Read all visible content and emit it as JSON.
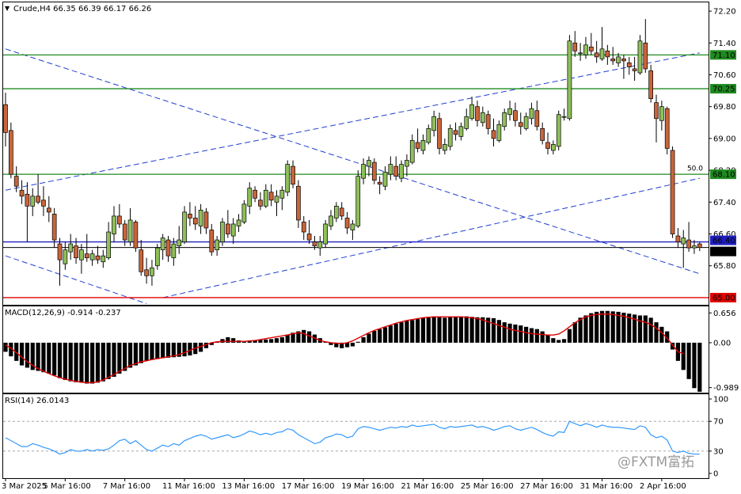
{
  "header": {
    "symbol_caret": "▼",
    "title": "Crude,H4  66.35 66.39 66.17 66.26"
  },
  "watermark": "@FXTM富拓",
  "colors": {
    "bull": "#8fbf5a",
    "bear": "#c8653a",
    "candle_outline": "#000000",
    "level_green": "#1f8a1f",
    "level_red": "#e00000",
    "level_blue": "#1f1fbf",
    "trend_blue": "#1f3fd0",
    "macd_signal": "#e00000",
    "rsi_line": "#3399ff",
    "grid": "#999999"
  },
  "chart_data": [
    {
      "type": "candlestick",
      "name": "main",
      "x_tick_labels": [
        "3 Mar 2025",
        "5 Mar 16:00",
        "7 Mar 16:00",
        "11 Mar 16:00",
        "13 Mar 16:00",
        "17 Mar 16:00",
        "19 Mar 16:00",
        "21 Mar 16:00",
        "25 Mar 16:00",
        "27 Mar 16:00",
        "31 Mar 16:00",
        "2 Apr 16:00"
      ],
      "y_ticks": [
        65.8,
        66.6,
        67.4,
        68.2,
        69.0,
        69.8,
        70.6,
        71.4,
        72.2
      ],
      "ylim": [
        64.82,
        72.42
      ],
      "ohlc": [
        [
          69.85,
          70.15,
          68.8,
          69.15
        ],
        [
          69.2,
          69.4,
          68.0,
          68.1
        ],
        [
          68.05,
          68.3,
          67.65,
          67.8
        ],
        [
          67.7,
          67.95,
          67.35,
          67.55
        ],
        [
          67.6,
          67.9,
          66.4,
          67.3
        ],
        [
          67.3,
          67.75,
          67.05,
          67.55
        ],
        [
          67.55,
          68.1,
          67.35,
          67.4
        ],
        [
          67.45,
          67.8,
          67.05,
          67.3
        ],
        [
          67.25,
          67.55,
          66.9,
          67.15
        ],
        [
          67.1,
          67.25,
          66.25,
          66.45
        ],
        [
          66.35,
          66.5,
          65.3,
          65.95
        ],
        [
          65.85,
          66.4,
          65.7,
          66.2
        ],
        [
          66.15,
          66.6,
          65.95,
          66.35
        ],
        [
          66.3,
          66.5,
          65.85,
          66.0
        ],
        [
          65.95,
          66.35,
          65.6,
          66.2
        ],
        [
          66.1,
          66.6,
          65.9,
          66.0
        ],
        [
          65.95,
          66.2,
          65.8,
          66.1
        ],
        [
          66.05,
          66.3,
          65.85,
          65.95
        ],
        [
          65.9,
          66.2,
          65.75,
          66.05
        ],
        [
          66.0,
          66.9,
          65.95,
          66.65
        ],
        [
          66.6,
          67.3,
          66.4,
          67.05
        ],
        [
          67.05,
          67.35,
          66.75,
          66.85
        ],
        [
          66.85,
          66.95,
          66.3,
          66.45
        ],
        [
          66.4,
          67.25,
          66.3,
          66.95
        ],
        [
          66.9,
          66.95,
          66.15,
          66.25
        ],
        [
          66.2,
          66.45,
          65.55,
          65.65
        ],
        [
          65.7,
          66.0,
          65.35,
          65.55
        ],
        [
          65.55,
          65.95,
          65.3,
          65.75
        ],
        [
          65.8,
          66.35,
          65.7,
          66.25
        ],
        [
          66.2,
          66.6,
          65.95,
          66.5
        ],
        [
          66.45,
          66.55,
          65.9,
          66.05
        ],
        [
          66.0,
          66.5,
          65.8,
          66.35
        ],
        [
          66.3,
          66.8,
          66.1,
          66.45
        ],
        [
          66.4,
          67.3,
          66.35,
          67.15
        ],
        [
          67.1,
          67.4,
          66.8,
          67.0
        ],
        [
          67.0,
          67.3,
          66.7,
          66.85
        ],
        [
          66.8,
          67.35,
          66.6,
          67.2
        ],
        [
          67.15,
          67.25,
          66.6,
          66.75
        ],
        [
          66.7,
          66.85,
          66.05,
          66.15
        ],
        [
          66.2,
          66.55,
          66.05,
          66.45
        ],
        [
          66.4,
          67.0,
          66.3,
          66.9
        ],
        [
          66.85,
          67.2,
          66.5,
          66.6
        ],
        [
          66.55,
          67.0,
          66.35,
          66.85
        ],
        [
          66.8,
          67.1,
          66.65,
          66.95
        ],
        [
          66.9,
          67.45,
          66.85,
          67.35
        ],
        [
          67.3,
          67.9,
          67.1,
          67.75
        ],
        [
          67.7,
          67.8,
          67.4,
          67.5
        ],
        [
          67.45,
          67.65,
          67.2,
          67.3
        ],
        [
          67.3,
          67.85,
          67.25,
          67.7
        ],
        [
          67.65,
          67.85,
          67.3,
          67.45
        ],
        [
          67.4,
          67.7,
          67.05,
          67.55
        ],
        [
          67.5,
          67.8,
          67.2,
          67.7
        ],
        [
          67.65,
          68.45,
          67.55,
          68.35
        ],
        [
          68.3,
          68.45,
          67.75,
          67.85
        ],
        [
          67.8,
          67.95,
          66.75,
          66.95
        ],
        [
          66.9,
          67.05,
          66.45,
          66.65
        ],
        [
          66.6,
          66.95,
          66.35,
          66.45
        ],
        [
          66.4,
          66.55,
          66.2,
          66.3
        ],
        [
          66.25,
          66.55,
          66.05,
          66.4
        ],
        [
          66.35,
          66.95,
          66.25,
          66.85
        ],
        [
          66.8,
          67.2,
          66.7,
          67.05
        ],
        [
          67.0,
          67.4,
          66.9,
          67.3
        ],
        [
          67.25,
          67.4,
          66.95,
          67.05
        ],
        [
          67.0,
          67.15,
          66.6,
          66.75
        ],
        [
          66.7,
          66.95,
          66.45,
          66.85
        ],
        [
          66.8,
          68.2,
          66.75,
          68.05
        ],
        [
          68.0,
          68.5,
          67.85,
          68.35
        ],
        [
          68.3,
          68.55,
          68.05,
          68.45
        ],
        [
          68.4,
          68.5,
          67.85,
          67.95
        ],
        [
          67.9,
          68.05,
          67.6,
          67.85
        ],
        [
          67.8,
          68.3,
          67.7,
          68.15
        ],
        [
          68.1,
          68.55,
          67.95,
          68.35
        ],
        [
          68.3,
          68.55,
          67.95,
          68.05
        ],
        [
          68.0,
          68.45,
          67.9,
          68.35
        ],
        [
          68.3,
          68.6,
          68.05,
          68.45
        ],
        [
          68.4,
          69.1,
          68.35,
          68.95
        ],
        [
          68.9,
          69.25,
          68.65,
          68.75
        ],
        [
          68.7,
          69.1,
          68.6,
          68.95
        ],
        [
          68.9,
          69.35,
          68.85,
          69.25
        ],
        [
          69.2,
          69.7,
          69.05,
          69.55
        ],
        [
          69.5,
          69.65,
          68.6,
          68.75
        ],
        [
          68.7,
          69.0,
          68.6,
          68.85
        ],
        [
          68.8,
          69.35,
          68.7,
          69.25
        ],
        [
          69.2,
          69.4,
          68.95,
          69.1
        ],
        [
          69.05,
          69.4,
          68.95,
          69.3
        ],
        [
          69.25,
          69.75,
          69.2,
          69.55
        ],
        [
          69.5,
          70.05,
          69.45,
          69.85
        ],
        [
          69.8,
          69.95,
          69.3,
          69.45
        ],
        [
          69.4,
          69.8,
          69.3,
          69.65
        ],
        [
          69.6,
          69.7,
          69.1,
          69.25
        ],
        [
          69.2,
          69.5,
          68.8,
          69.0
        ],
        [
          68.95,
          69.45,
          68.9,
          69.35
        ],
        [
          69.3,
          69.75,
          69.2,
          69.65
        ],
        [
          69.6,
          69.95,
          69.45,
          69.75
        ],
        [
          69.7,
          69.9,
          69.3,
          69.45
        ],
        [
          69.4,
          69.65,
          69.1,
          69.3
        ],
        [
          69.25,
          69.65,
          69.2,
          69.55
        ],
        [
          69.5,
          69.9,
          69.35,
          69.75
        ],
        [
          69.7,
          69.95,
          69.2,
          69.3
        ],
        [
          69.25,
          69.4,
          68.85,
          68.95
        ],
        [
          68.9,
          69.15,
          68.6,
          68.75
        ],
        [
          68.7,
          68.95,
          68.6,
          68.85
        ],
        [
          68.8,
          69.7,
          68.7,
          69.6
        ],
        [
          69.55,
          69.75,
          69.45,
          69.55
        ],
        [
          69.5,
          71.6,
          69.45,
          71.45
        ],
        [
          71.4,
          71.7,
          71.05,
          71.2
        ],
        [
          71.15,
          71.4,
          70.95,
          71.15
        ],
        [
          71.1,
          71.55,
          71.0,
          71.35
        ],
        [
          71.3,
          71.65,
          71.1,
          71.2
        ],
        [
          71.15,
          71.45,
          70.9,
          71.05
        ],
        [
          71.0,
          71.8,
          70.95,
          71.25
        ],
        [
          71.2,
          71.35,
          70.85,
          71.05
        ],
        [
          71.0,
          71.3,
          70.85,
          70.95
        ],
        [
          70.9,
          71.15,
          70.8,
          71.05
        ],
        [
          71.0,
          71.1,
          70.5,
          70.95
        ],
        [
          70.9,
          71.05,
          70.6,
          70.8
        ],
        [
          70.75,
          71.05,
          70.45,
          70.7
        ],
        [
          70.65,
          71.6,
          70.6,
          71.45
        ],
        [
          71.4,
          72.0,
          70.65,
          70.75
        ],
        [
          70.7,
          70.85,
          69.9,
          70.0
        ],
        [
          69.9,
          70.1,
          68.9,
          69.5
        ],
        [
          69.45,
          69.95,
          69.2,
          69.8
        ],
        [
          69.75,
          69.8,
          68.6,
          68.75
        ],
        [
          68.7,
          68.8,
          66.5,
          66.6
        ],
        [
          66.55,
          66.75,
          66.25,
          66.4
        ],
        [
          66.35,
          66.7,
          65.75,
          66.5
        ],
        [
          66.45,
          66.9,
          66.15,
          66.25
        ],
        [
          66.25,
          66.45,
          66.1,
          66.3
        ],
        [
          66.35,
          66.39,
          66.17,
          66.26
        ]
      ],
      "levels": [
        {
          "value": 71.1,
          "label": "71.10",
          "color": "green"
        },
        {
          "value": 70.25,
          "label": "70.25",
          "color": "green"
        },
        {
          "value": 68.1,
          "label": "68.10",
          "color": "green"
        },
        {
          "value": 66.4,
          "label": "66.40",
          "color": "blue"
        },
        {
          "value": 66.26,
          "label": "66.26",
          "color": "black"
        },
        {
          "value": 65.0,
          "label": "65.00",
          "color": "red"
        }
      ],
      "trendlines": [
        {
          "x1": 0,
          "y1": 67.7,
          "x2": 128,
          "y2": 71.15
        },
        {
          "x1": 0,
          "y1": 71.25,
          "x2": 128,
          "y2": 65.6
        },
        {
          "x1": 29,
          "y1": 65.0,
          "x2": 128,
          "y2": 68.0
        },
        {
          "x1": 0,
          "y1": 66.05,
          "x2": 26,
          "y2": 64.85
        }
      ],
      "annotations": [
        {
          "text": "50.0",
          "index": 127,
          "y": 68.15
        }
      ]
    },
    {
      "type": "bar+line",
      "name": "macd",
      "title": "MACD(12,26,9) -0.914 -0.237",
      "y_ticks": [
        0.656,
        0.0,
        -0.989
      ],
      "y_tick_labels": [
        "0.656",
        "0.00",
        "-0.989"
      ],
      "ylim": [
        -1.1,
        0.8
      ],
      "histogram": [
        -0.2,
        -0.3,
        -0.4,
        -0.5,
        -0.55,
        -0.6,
        -0.62,
        -0.65,
        -0.68,
        -0.72,
        -0.78,
        -0.82,
        -0.85,
        -0.87,
        -0.88,
        -0.9,
        -0.9,
        -0.88,
        -0.85,
        -0.8,
        -0.75,
        -0.68,
        -0.62,
        -0.55,
        -0.5,
        -0.45,
        -0.4,
        -0.38,
        -0.36,
        -0.34,
        -0.33,
        -0.32,
        -0.31,
        -0.3,
        -0.28,
        -0.25,
        -0.2,
        -0.12,
        -0.05,
        0.02,
        0.08,
        0.12,
        0.1,
        0.05,
        0.02,
        0.03,
        0.05,
        0.06,
        0.07,
        0.08,
        0.1,
        0.12,
        0.18,
        0.22,
        0.25,
        0.28,
        0.25,
        0.18,
        0.1,
        0.02,
        -0.05,
        -0.1,
        -0.12,
        -0.1,
        -0.08,
        0.02,
        0.12,
        0.2,
        0.26,
        0.3,
        0.34,
        0.38,
        0.42,
        0.45,
        0.48,
        0.5,
        0.52,
        0.55,
        0.57,
        0.58,
        0.56,
        0.55,
        0.56,
        0.57,
        0.58,
        0.58,
        0.57,
        0.56,
        0.56,
        0.55,
        0.54,
        0.5,
        0.45,
        0.42,
        0.4,
        0.38,
        0.35,
        0.32,
        0.3,
        0.25,
        0.18,
        0.1,
        0.06,
        0.08,
        0.3,
        0.45,
        0.55,
        0.6,
        0.65,
        0.68,
        0.7,
        0.7,
        0.69,
        0.68,
        0.66,
        0.64,
        0.62,
        0.6,
        0.6,
        0.55,
        0.45,
        0.35,
        0.25,
        -0.15,
        -0.4,
        -0.6,
        -0.8,
        -1.0,
        -1.08
      ],
      "signal": [
        -0.05,
        -0.12,
        -0.22,
        -0.32,
        -0.42,
        -0.5,
        -0.57,
        -0.63,
        -0.68,
        -0.73,
        -0.77,
        -0.8,
        -0.83,
        -0.85,
        -0.87,
        -0.88,
        -0.88,
        -0.86,
        -0.82,
        -0.76,
        -0.7,
        -0.63,
        -0.57,
        -0.5,
        -0.46,
        -0.42,
        -0.4,
        -0.37,
        -0.35,
        -0.33,
        -0.31,
        -0.29,
        -0.26,
        -0.22,
        -0.17,
        -0.12,
        -0.08,
        -0.04,
        0.0,
        0.02,
        0.03,
        0.03,
        0.03,
        0.03,
        0.03,
        0.04,
        0.05,
        0.07,
        0.09,
        0.11,
        0.13,
        0.15,
        0.17,
        0.2,
        0.22,
        0.2,
        0.15,
        0.1,
        0.05,
        0.02,
        0.0,
        -0.01,
        -0.02,
        0.0,
        0.04,
        0.1,
        0.16,
        0.22,
        0.27,
        0.31,
        0.35,
        0.39,
        0.43,
        0.46,
        0.49,
        0.51,
        0.53,
        0.55,
        0.56,
        0.57,
        0.57,
        0.57,
        0.57,
        0.57,
        0.57,
        0.56,
        0.55,
        0.53,
        0.5,
        0.46,
        0.42,
        0.38,
        0.34,
        0.3,
        0.27,
        0.25,
        0.22,
        0.2,
        0.19,
        0.18,
        0.17,
        0.17,
        0.19,
        0.26,
        0.35,
        0.44,
        0.51,
        0.57,
        0.6,
        0.62,
        0.63,
        0.63,
        0.62,
        0.6,
        0.58,
        0.55,
        0.52,
        0.48,
        0.45,
        0.4,
        0.32,
        0.22,
        0.1,
        -0.05,
        -0.2,
        -0.24
      ]
    },
    {
      "type": "line",
      "name": "rsi",
      "title": "RSI(14) 26.0143",
      "y_ticks": [
        100,
        70,
        30,
        0
      ],
      "y_tick_labels": [
        "100",
        "70",
        "30",
        "0"
      ],
      "ylim": [
        0,
        100
      ],
      "values": [
        48,
        44,
        40,
        36,
        36,
        40,
        38,
        35,
        33,
        30,
        26,
        28,
        32,
        30,
        30,
        32,
        30,
        32,
        31,
        33,
        38,
        44,
        46,
        40,
        44,
        38,
        32,
        30,
        34,
        38,
        36,
        40,
        38,
        44,
        47,
        50,
        52,
        50,
        46,
        48,
        50,
        52,
        48,
        50,
        53,
        57,
        55,
        52,
        54,
        52,
        55,
        56,
        60,
        58,
        52,
        48,
        44,
        40,
        42,
        48,
        50,
        53,
        52,
        48,
        50,
        60,
        63,
        62,
        60,
        58,
        60,
        62,
        61,
        63,
        62,
        65,
        63,
        64,
        65,
        66,
        62,
        60,
        63,
        62,
        63,
        64,
        65,
        62,
        63,
        61,
        58,
        60,
        63,
        64,
        60,
        58,
        60,
        62,
        59,
        55,
        52,
        50,
        56,
        55,
        70,
        67,
        64,
        67,
        65,
        62,
        65,
        63,
        62,
        62,
        61,
        60,
        59,
        64,
        62,
        52,
        48,
        50,
        45,
        30,
        28,
        30,
        27,
        26,
        26
      ]
    }
  ]
}
